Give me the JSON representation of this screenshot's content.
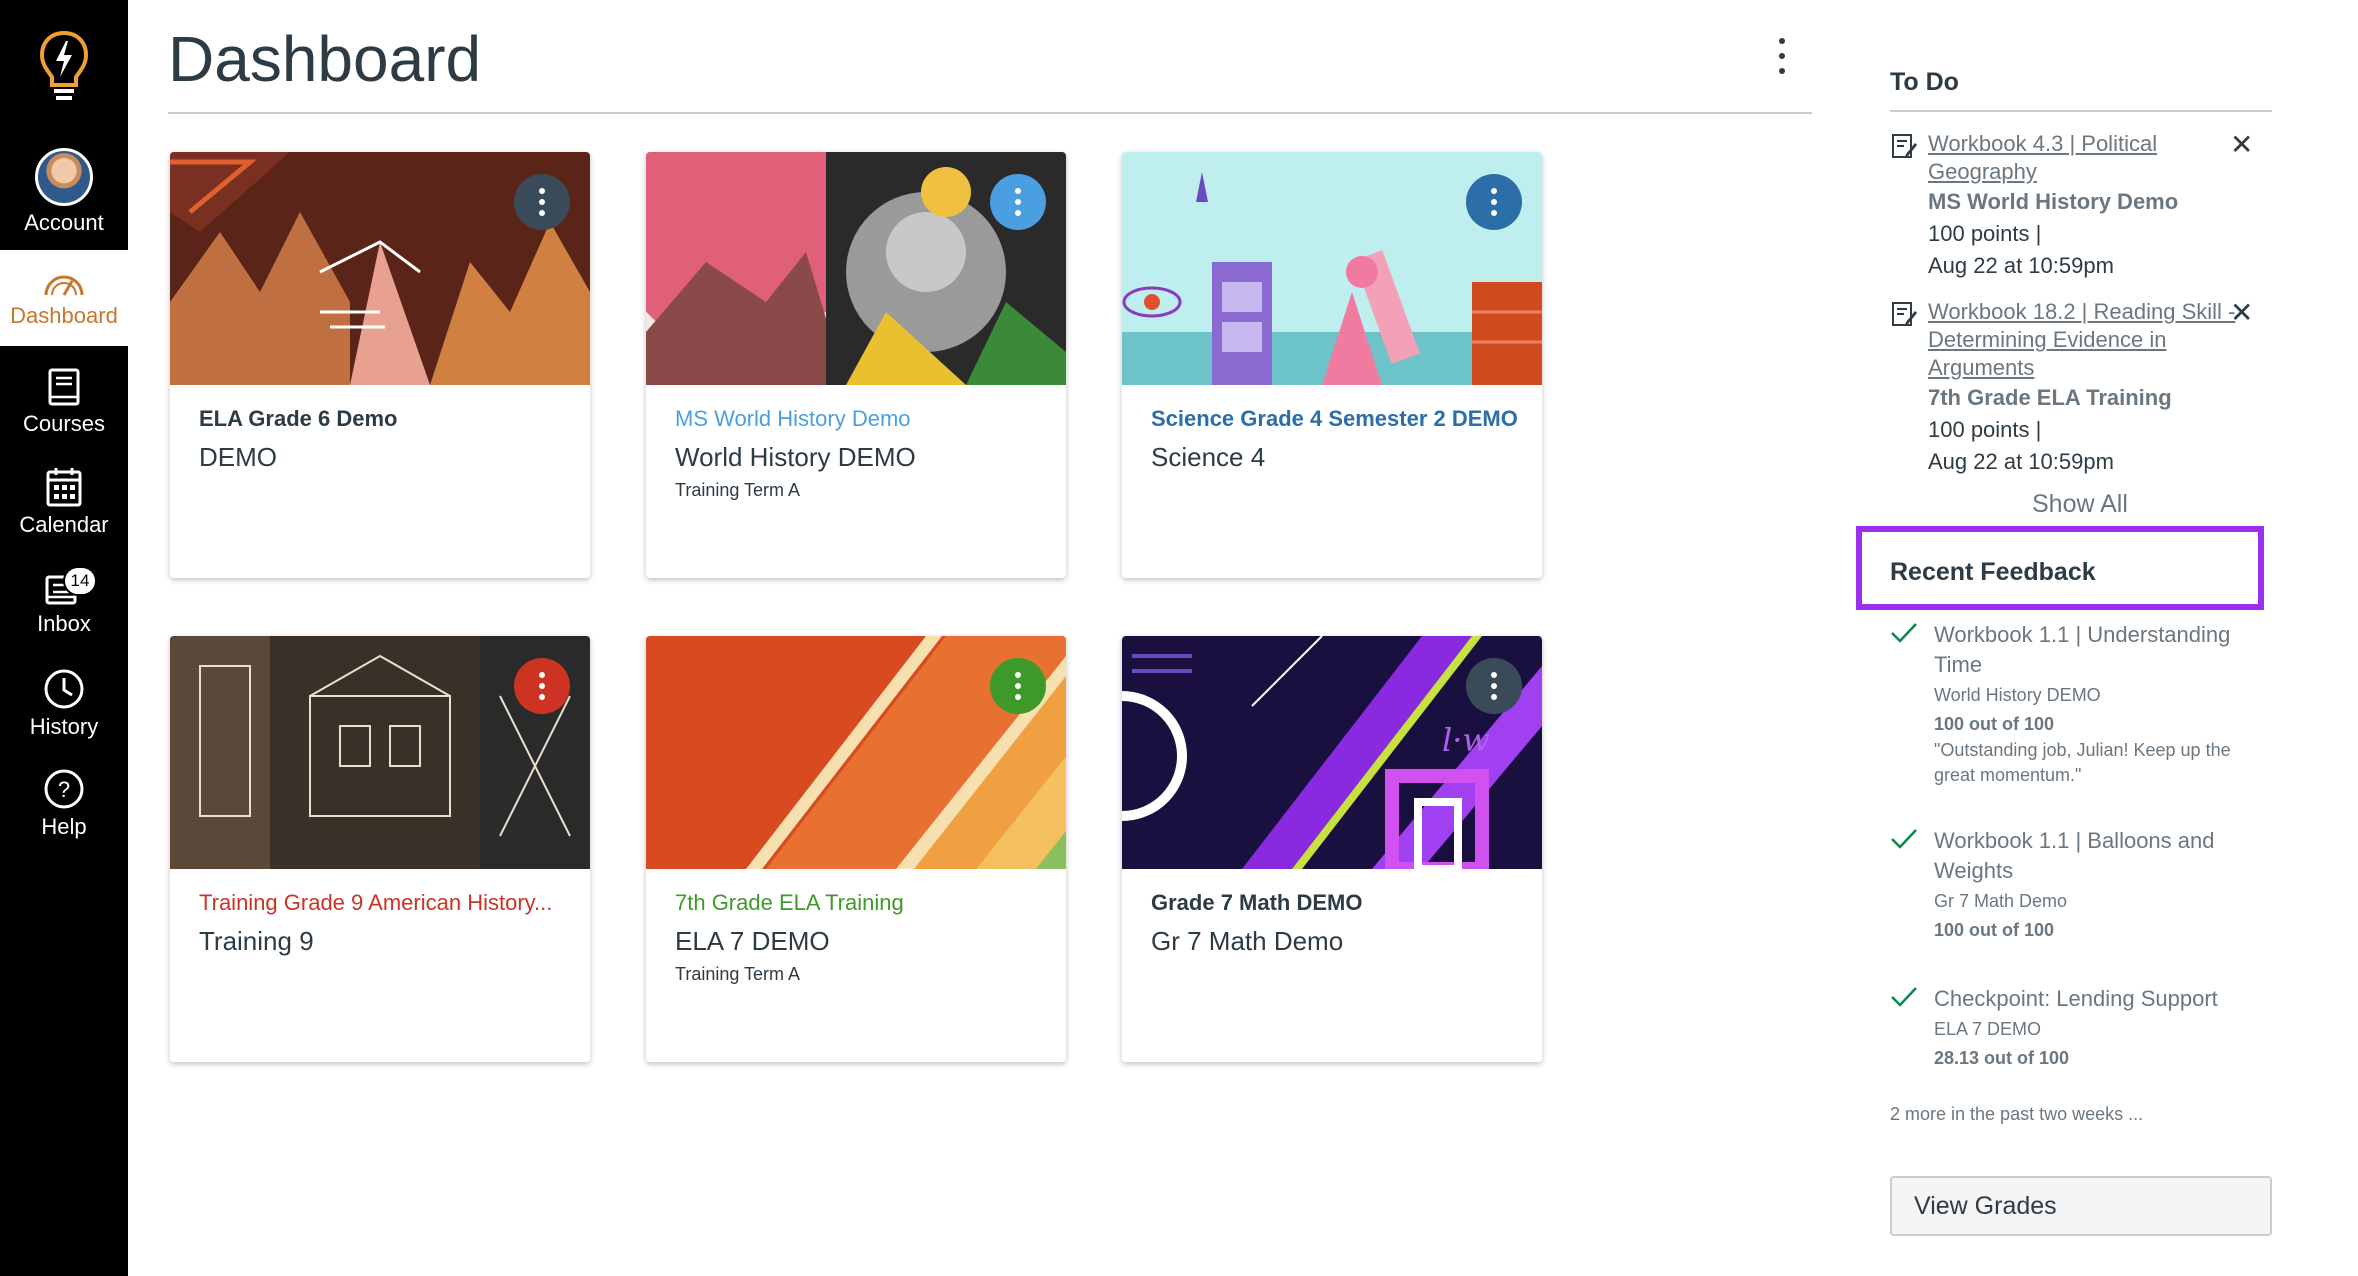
{
  "nav": {
    "account": "Account",
    "dashboard": "Dashboard",
    "courses": "Courses",
    "calendar": "Calendar",
    "inbox": "Inbox",
    "inbox_badge": "14",
    "history": "History",
    "help": "Help"
  },
  "page": {
    "title": "Dashboard"
  },
  "cards": [
    {
      "title": "ELA Grade 6 Demo",
      "subtitle": "DEMO",
      "term": "",
      "color": "#394b58"
    },
    {
      "title": "MS World History Demo",
      "subtitle": "World History DEMO",
      "term": "Training Term A",
      "color": "#4a9fe0"
    },
    {
      "title": "Science Grade 4 Semester 2 DEMO",
      "subtitle": "Science 4",
      "term": "",
      "color": "#2b6ea8"
    },
    {
      "title": "Training Grade 9 American History...",
      "subtitle": "Training 9",
      "term": "",
      "color": "#cc3322"
    },
    {
      "title": "7th Grade ELA Training",
      "subtitle": "ELA 7 DEMO",
      "term": "Training Term A",
      "color": "#3d9a2a"
    },
    {
      "title": "Grade 7 Math DEMO",
      "subtitle": "Gr 7 Math Demo",
      "term": "",
      "color": "#394b58"
    }
  ],
  "todo": {
    "heading": "To Do",
    "items": [
      {
        "link": "Workbook 4.3 | Political Geography",
        "course": "MS World History Demo",
        "points": "100 points  |",
        "due": "Aug 22 at 10:59pm"
      },
      {
        "link": "Workbook 18.2 | Reading Skill - Determining Evidence in Arguments",
        "course": "7th Grade ELA Training",
        "points": "100 points  |",
        "due": "Aug 22 at 10:59pm"
      }
    ],
    "show_all": "Show All"
  },
  "feedback": {
    "heading": "Recent Feedback",
    "items": [
      {
        "title": "Workbook 1.1 | Understanding Time",
        "course": "World History DEMO",
        "score": "100 out of 100",
        "comment": "\"Outstanding job, Julian! Keep up the great momentum.\""
      },
      {
        "title": "Workbook 1.1 | Balloons and Weights",
        "course": "Gr 7 Math Demo",
        "score": "100 out of 100",
        "comment": ""
      },
      {
        "title": "Checkpoint: Lending Support",
        "course": "ELA 7 DEMO",
        "score": "28.13 out of 100",
        "comment": ""
      }
    ],
    "more": "2 more in the past two weeks ..."
  },
  "view_grades": "View Grades",
  "colors": {
    "accent": "#9b30ef",
    "nav_active": "#c7772b",
    "check": "#0b874b"
  }
}
